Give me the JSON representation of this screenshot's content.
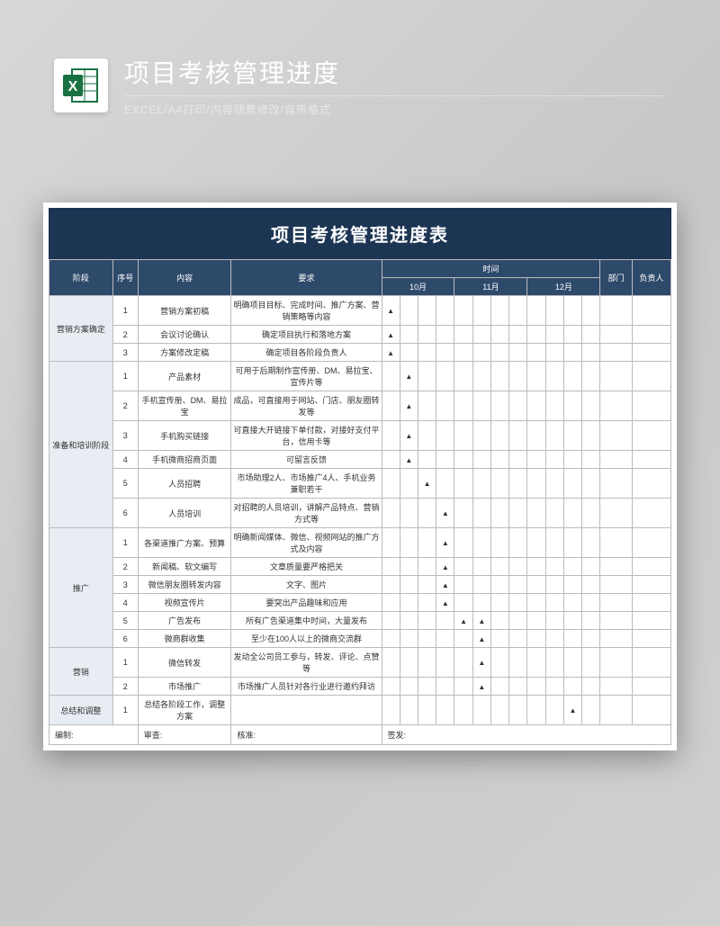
{
  "header": {
    "title": "项目考核管理进度",
    "subtitle": "EXCEL/A4打印/内容随意修改/自带格式"
  },
  "sheet": {
    "title": "项目考核管理进度表",
    "columns": {
      "phase": "阶段",
      "seq": "序号",
      "content": "内容",
      "requirement": "要求",
      "time": "时间",
      "months": [
        "10月",
        "11月",
        "12月"
      ],
      "dept": "部门",
      "owner": "负责人"
    },
    "phases": [
      {
        "name": "营销方案确定",
        "rows": [
          {
            "seq": "1",
            "content": "营销方案初稿",
            "req": "明确项目目标、完成时间、推广方案、营销策略等内容",
            "marks": [
              0
            ]
          },
          {
            "seq": "2",
            "content": "会议讨论确认",
            "req": "确定项目执行和落地方案",
            "marks": [
              0
            ]
          },
          {
            "seq": "3",
            "content": "方案修改定稿",
            "req": "确定项目各阶段负责人",
            "marks": [
              0
            ]
          }
        ]
      },
      {
        "name": "准备和培训阶段",
        "rows": [
          {
            "seq": "1",
            "content": "产品素材",
            "req": "可用于后期制作宣传册、DM、易拉宝、宣传片等",
            "marks": [
              1
            ]
          },
          {
            "seq": "2",
            "content": "手机宣传册、DM、易拉宝",
            "req": "成品，可直接用于网站、门店、朋友圈转发等",
            "marks": [
              1
            ]
          },
          {
            "seq": "3",
            "content": "手机购买链接",
            "req": "可直接大开链接下单付款，对接好支付平台，信用卡等",
            "marks": [
              1
            ]
          },
          {
            "seq": "4",
            "content": "手机微商招商页面",
            "req": "可留言反馈",
            "marks": [
              1
            ]
          },
          {
            "seq": "5",
            "content": "人员招聘",
            "req": "市场助理2人、市场推广4人、手机业务兼职若干",
            "marks": [
              2
            ]
          },
          {
            "seq": "6",
            "content": "人员培训",
            "req": "对招聘的人员培训，讲解产品特点、营销方式等",
            "marks": [
              3
            ]
          }
        ]
      },
      {
        "name": "推广",
        "rows": [
          {
            "seq": "1",
            "content": "各渠道推广方案、预算",
            "req": "明确新闻媒体、微信、视频网站的推广方式及内容",
            "marks": [
              3
            ]
          },
          {
            "seq": "2",
            "content": "新闻稿、软文编写",
            "req": "文章质量要严格把关",
            "marks": [
              3
            ]
          },
          {
            "seq": "3",
            "content": "微信朋友圈转发内容",
            "req": "文字、图片",
            "marks": [
              3
            ]
          },
          {
            "seq": "4",
            "content": "视频宣传片",
            "req": "要突出产品趣味和应用",
            "marks": [
              3
            ]
          },
          {
            "seq": "5",
            "content": "广告发布",
            "req": "所有广告渠道集中时间，大量发布",
            "marks": [
              4,
              5
            ]
          },
          {
            "seq": "6",
            "content": "微商群收集",
            "req": "至少在100人以上的微商交流群",
            "marks": [
              5
            ]
          }
        ]
      },
      {
        "name": "营销",
        "rows": [
          {
            "seq": "1",
            "content": "微信转发",
            "req": "发动全公司员工参与，转发、评论、点赞等",
            "marks": [
              5
            ]
          },
          {
            "seq": "2",
            "content": "市场推广",
            "req": "市场推广人员针对各行业进行邀约拜访",
            "marks": [
              5
            ]
          }
        ]
      },
      {
        "name": "总结和调整",
        "rows": [
          {
            "seq": "1",
            "content": "总结各阶段工作，调整方案",
            "req": "",
            "marks": [
              10
            ]
          }
        ]
      }
    ],
    "footer": {
      "compile": "编制:",
      "review": "审查:",
      "approve": "核准:",
      "sign": "签发:"
    }
  }
}
